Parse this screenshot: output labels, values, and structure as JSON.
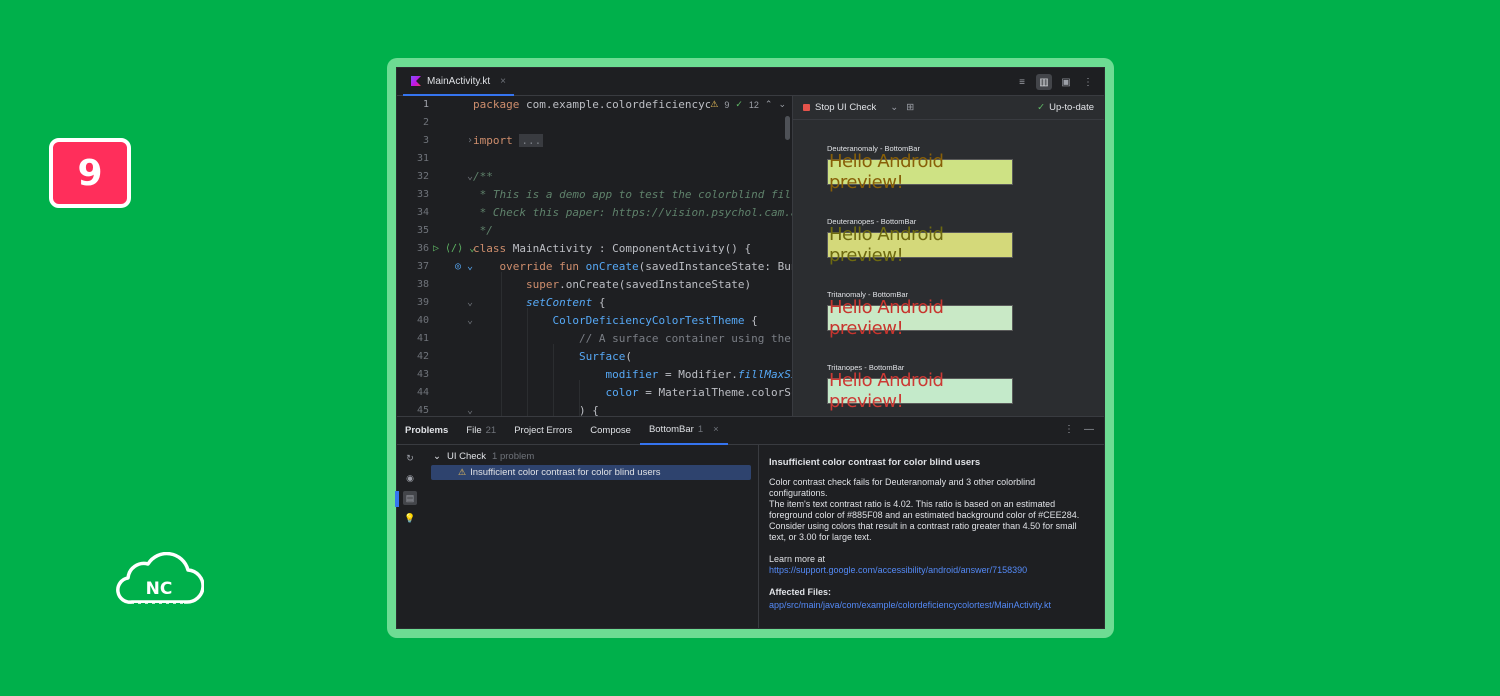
{
  "badge": {
    "number": "9"
  },
  "logo": {
    "text": "NC"
  },
  "editor_tab": {
    "filename": "MainActivity.kt",
    "close": "×"
  },
  "view_buttons": [
    "≡",
    "▥",
    "▣",
    "⋮"
  ],
  "inspections": {
    "warnings": "9",
    "checks": "12"
  },
  "code_lines": [
    {
      "num": "1",
      "html": "<span class=\"kw\">package</span> com.example.colordeficiencycol"
    },
    {
      "num": "2",
      "html": ""
    },
    {
      "num": "3",
      "html": "<span class=\"kw\">import</span> <span class=\"fold\">...</span>"
    },
    {
      "num": "31",
      "html": ""
    },
    {
      "num": "32",
      "html": "<span class=\"cm\">/**</span>"
    },
    {
      "num": "33",
      "html": "<span class=\"cm\"> * This is a demo app to test the colorblind filt</span>"
    },
    {
      "num": "34",
      "html": "<span class=\"cm\"> * Check this paper: https://vision.psychol.cam.ac</span>"
    },
    {
      "num": "35",
      "html": "<span class=\"cm\"> */</span>"
    },
    {
      "num": "36",
      "html": "<span class=\"kw\">class</span> MainActivity : ComponentActivity() {"
    },
    {
      "num": "37",
      "html": "    <span class=\"kw\">override fun</span> <span class=\"fn\">onCreate</span>(savedInstanceState: Bund"
    },
    {
      "num": "38",
      "html": "        <span class=\"kw\">super</span>.onCreate(savedInstanceState)"
    },
    {
      "num": "39",
      "html": "        <span class=\"it\">setContent</span> {"
    },
    {
      "num": "40",
      "html": "            <span class=\"cl-green\">ColorDeficiencyColorTestTheme</span> {"
    },
    {
      "num": "41",
      "html": "                <span class=\"cm\" style=\"font-style:normal;color:#7a7e85\">// A surface container using the</span>"
    },
    {
      "num": "42",
      "html": "                <span class=\"cl-green\">Surface</span>("
    },
    {
      "num": "43",
      "html": "                    <span class=\"cl-green\">modifier</span> = Modifier.<span class=\"it\">fillMaxSi</span>"
    },
    {
      "num": "44",
      "html": "                    <span class=\"cl-green\">color</span> = MaterialTheme.colorSch"
    },
    {
      "num": "45",
      "html": "                ) {"
    }
  ],
  "preview": {
    "stop_label": "Stop UI Check",
    "status": "Up-to-date",
    "items": [
      {
        "title": "Deuteranomaly - BottomBar",
        "text": "Hello Android preview!",
        "bg": "#cee284",
        "fg": "#885f08"
      },
      {
        "title": "Deuteranopes - BottomBar",
        "text": "Hello Android preview!",
        "bg": "#d4d97a",
        "fg": "#6e6a10"
      },
      {
        "title": "Tritanomaly - BottomBar",
        "text": "Hello Android preview!",
        "bg": "#c9e9c6",
        "fg": "#c8352e"
      },
      {
        "title": "Tritanopes - BottomBar",
        "text": "Hello Android preview!",
        "bg": "#c4eaca",
        "fg": "#cc3a35"
      }
    ]
  },
  "problems": {
    "tabs": [
      {
        "label": "Problems",
        "count": ""
      },
      {
        "label": "File",
        "count": "21"
      },
      {
        "label": "Project Errors",
        "count": ""
      },
      {
        "label": "Compose",
        "count": ""
      },
      {
        "label": "BottomBar",
        "count": "1"
      }
    ],
    "tree_root": "UI Check",
    "tree_root_count": "1 problem",
    "tree_item": "Insufficient color contrast for color blind users",
    "detail": {
      "title": "Insufficient color contrast for color blind users",
      "para1": "Color contrast check fails for Deuteranomaly and 3 other colorblind configurations.",
      "para2": "The item's text contrast ratio is 4.02. This ratio is based on an estimated foreground color of #885F08 and an estimated background color of #CEE284. Consider using colors that result in a contrast ratio greater than 4.50 for small text, or 3.00 for large text.",
      "learn_more": "Learn more at",
      "link": "https://support.google.com/accessibility/android/answer/7158390",
      "affected_label": "Affected Files:",
      "affected_file": "app/src/main/java/com/example/colordeficiencycolortest/MainActivity.kt"
    }
  }
}
